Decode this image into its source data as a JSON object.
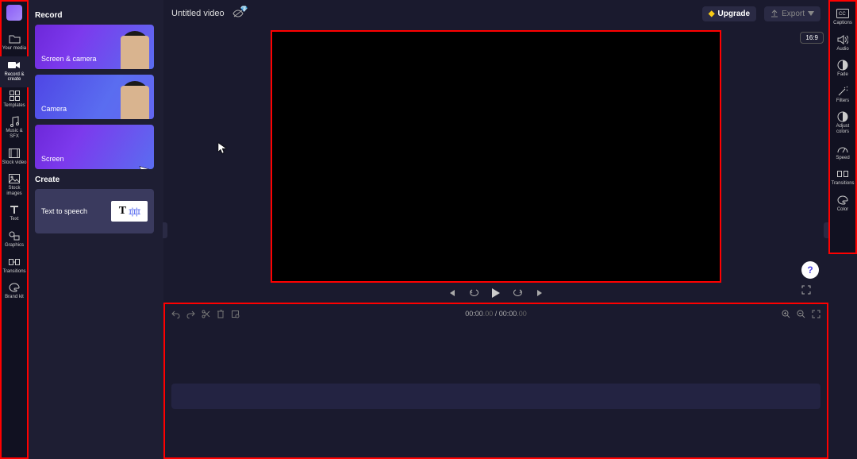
{
  "app": {
    "title": "Untitled video"
  },
  "left_nav": [
    {
      "id": "your-media",
      "label": "Your media",
      "icon": "folder-icon"
    },
    {
      "id": "record-create",
      "label": "Record & create",
      "icon": "camera-icon",
      "active": true
    },
    {
      "id": "templates",
      "label": "Templates",
      "icon": "grid-icon"
    },
    {
      "id": "music-sfx",
      "label": "Music & SFX",
      "icon": "music-icon"
    },
    {
      "id": "stock-video",
      "label": "Stock video",
      "icon": "film-icon"
    },
    {
      "id": "stock-images",
      "label": "Stock images",
      "icon": "image-icon"
    },
    {
      "id": "text",
      "label": "Text",
      "icon": "text-icon"
    },
    {
      "id": "graphics",
      "label": "Graphics",
      "icon": "shapes-icon"
    },
    {
      "id": "transitions",
      "label": "Transitions",
      "icon": "arrows-icon"
    },
    {
      "id": "brand-kit",
      "label": "Brand kit",
      "icon": "palette-icon"
    }
  ],
  "record_panel": {
    "sections": {
      "record": {
        "title": "Record",
        "items": [
          {
            "id": "screen-camera",
            "label": "Screen & camera"
          },
          {
            "id": "camera",
            "label": "Camera"
          },
          {
            "id": "screen",
            "label": "Screen"
          }
        ]
      },
      "create": {
        "title": "Create",
        "items": [
          {
            "id": "text-to-speech",
            "label": "Text to speech"
          }
        ]
      }
    }
  },
  "right_nav": [
    {
      "id": "captions",
      "label": "Captions",
      "icon": "cc-icon"
    },
    {
      "id": "audio",
      "label": "Audio",
      "icon": "speaker-icon"
    },
    {
      "id": "fade",
      "label": "Fade",
      "icon": "fade-icon"
    },
    {
      "id": "filters",
      "label": "Filters",
      "icon": "wand-icon"
    },
    {
      "id": "adjust-colors",
      "label": "Adjust colors",
      "icon": "contrast-icon"
    },
    {
      "id": "speed",
      "label": "Speed",
      "icon": "gauge-icon"
    },
    {
      "id": "transitions-r",
      "label": "Transitions",
      "icon": "transition-icon"
    },
    {
      "id": "color",
      "label": "Color",
      "icon": "paint-icon"
    }
  ],
  "topbar": {
    "upgrade": "Upgrade",
    "export": "Export"
  },
  "canvas": {
    "aspect": "16:9"
  },
  "player": {
    "controls": [
      "skip-start",
      "step-back",
      "play",
      "step-fwd",
      "skip-end"
    ]
  },
  "timeline": {
    "current": "00:00",
    "current_ms": ".00",
    "duration": "00:00",
    "duration_ms": ".00",
    "sep": " / ",
    "edit_tools": [
      "undo",
      "redo",
      "split",
      "delete",
      "crop"
    ],
    "zoom_tools": [
      "zoom-in",
      "zoom-out",
      "fit"
    ]
  },
  "help": "?"
}
